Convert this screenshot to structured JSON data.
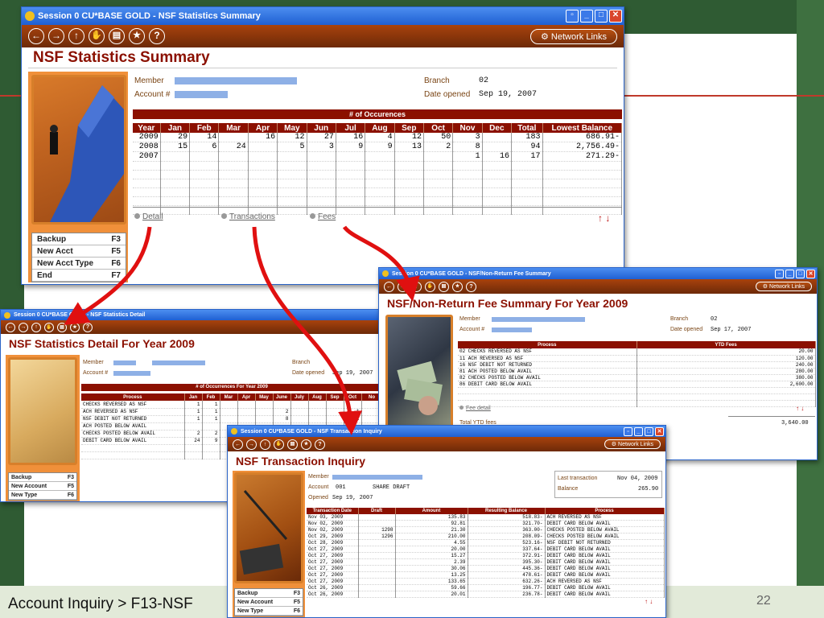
{
  "slide": {
    "caption": "Account Inquiry > F13-NSF",
    "page_number": "22"
  },
  "summary": {
    "window_title": "Session 0 CU*BASE GOLD - NSF Statistics Summary",
    "page_title": "NSF Statistics Summary",
    "network_links": "Network Links",
    "member_label": "Member",
    "account_label": "Account #",
    "branch_label": "Branch",
    "branch_value": "02",
    "date_opened_label": "Date opened",
    "date_opened_value": "Sep 19, 2007",
    "occurrences_header": "# of Occurences",
    "columns": [
      "Year",
      "Jan",
      "Feb",
      "Mar",
      "Apr",
      "May",
      "Jun",
      "Jul",
      "Aug",
      "Sep",
      "Oct",
      "Nov",
      "Dec",
      "Total",
      "Lowest Balance"
    ],
    "rows": [
      [
        "2009",
        "29",
        "14",
        "",
        "16",
        "12",
        "27",
        "16",
        "4",
        "12",
        "50",
        "3",
        "",
        "183",
        "686.91-"
      ],
      [
        "2008",
        "15",
        "6",
        "24",
        "",
        "5",
        "3",
        "9",
        "9",
        "13",
        "2",
        "8",
        "",
        "94",
        "2,756.49-"
      ],
      [
        "2007",
        "",
        "",
        "",
        "",
        "",
        "",
        "",
        "",
        "",
        "",
        "1",
        "16",
        "17",
        "271.29-"
      ]
    ],
    "links": [
      "Detail",
      "Transactions",
      "Fees"
    ],
    "fkeys": [
      [
        "Backup",
        "F3"
      ],
      [
        "New Acct",
        "F5"
      ],
      [
        "New Acct Type",
        "F6"
      ],
      [
        "End",
        "F7"
      ]
    ]
  },
  "detail": {
    "window_title": "Session 0 CU*BASE GOLD - NSF Statistics Detail",
    "page_title": "NSF Statistics Detail For Year 2009",
    "member_label": "Member",
    "account_label": "Account #",
    "branch_label": "Branch",
    "date_opened_label": "Date opened",
    "date_opened_value": "Sep 19, 2007",
    "grid_header": "# of Occurrences For Year 2009",
    "columns": [
      "Process",
      "Jan",
      "Feb",
      "Mar",
      "Apr",
      "May",
      "June",
      "July",
      "Aug",
      "Sep",
      "Oct",
      "No"
    ],
    "rows": [
      [
        "CHECKS REVERSED AS NSF",
        "1",
        "1",
        "",
        "",
        "",
        "",
        "",
        "",
        "",
        "",
        ""
      ],
      [
        "ACH REVERSED AS NSF",
        "1",
        "1",
        "",
        "",
        "",
        "2",
        "",
        "",
        "",
        "1",
        ""
      ],
      [
        "NSF DEBIT NOT RETURNED",
        "1",
        "1",
        "",
        "",
        "",
        "8",
        "",
        "",
        "",
        "2",
        ""
      ],
      [
        "ACH POSTED BELOW AVAIL",
        "",
        "",
        "",
        "",
        "",
        "",
        "",
        "",
        "",
        "",
        ""
      ],
      [
        "CHECKS POSTED BELOW AVAIL",
        "2",
        "2",
        "",
        "",
        "",
        "",
        "",
        "",
        "",
        "",
        ""
      ],
      [
        "DEBIT CARD BELOW AVAIL",
        "24",
        "9",
        "",
        "",
        "",
        "",
        "",
        "",
        "",
        "",
        ""
      ]
    ],
    "fkeys": [
      [
        "Backup",
        "F3"
      ],
      [
        "New Account",
        "F5"
      ],
      [
        "New Type",
        "F6"
      ]
    ]
  },
  "fees": {
    "window_title": "Session 0 CU*BASE GOLD - NSF/Non-Return Fee Summary",
    "page_title": "NSF/Non-Return Fee Summary For Year 2009",
    "network_links": "Network Links",
    "member_label": "Member",
    "account_label": "Account #",
    "branch_label": "Branch",
    "branch_value": "02",
    "date_opened_label": "Date opened",
    "date_opened_value": "Sep 17, 2007",
    "columns": [
      "Process",
      "YTD Fees"
    ],
    "rows": [
      [
        "02 CHECKS REVERSED AS NSF",
        "20.00"
      ],
      [
        "11 ACH REVERSED AS NSF",
        "120.00"
      ],
      [
        "16 NSF DEBIT NOT RETURNED",
        "240.00"
      ],
      [
        "81 ACH POSTED BELOW AVAIL",
        "280.00"
      ],
      [
        "82 CHECKS POSTED BELOW AVAIL",
        "380.00"
      ],
      [
        "86 DEBIT CARD BELOW AVAIL",
        "2,600.00"
      ]
    ],
    "fee_detail_link": "Fee detail",
    "total_label": "Total YTD fees",
    "total_value": "3,640.00"
  },
  "transactions": {
    "window_title": "Session 0 CU*BASE GOLD - NSF Transaction Inquiry",
    "page_title": "NSF Transaction Inquiry",
    "network_links": "Network Links",
    "member_label": "Member",
    "account_label": "Account",
    "account_value": "001",
    "account_type": "SHARE DRAFT",
    "opened_label": "Opened",
    "opened_value": "Sep 19, 2007",
    "last_tx_label": "Last transaction",
    "last_tx_value": "Nov 04, 2009",
    "balance_label": "Balance",
    "balance_value": "265.90",
    "columns": [
      "Transaction Date",
      "Draft",
      "Amount",
      "Resulting Balance",
      "Process"
    ],
    "rows": [
      [
        "Nov 03, 2009",
        "",
        "135.83",
        "518.83-",
        "ACH REVERSED AS NSF"
      ],
      [
        "Nov 02, 2009",
        "",
        "92.81",
        "321.70-",
        "DEBIT CARD BELOW AVAIL"
      ],
      [
        "Nov 02, 2009",
        "1298",
        "21.30",
        "363.00-",
        "CHECKS POSTED BELOW AVAIL"
      ],
      [
        "Oct 29, 2009",
        "1296",
        "210.00",
        "208.09-",
        "CHECKS POSTED BELOW AVAIL"
      ],
      [
        "Oct 28, 2009",
        "",
        "4.55",
        "523.16-",
        "NSF DEBIT NOT RETURNED"
      ],
      [
        "Oct 27, 2009",
        "",
        "20.00",
        "337.64-",
        "DEBIT CARD BELOW AVAIL"
      ],
      [
        "Oct 27, 2009",
        "",
        "15.27",
        "372.91-",
        "DEBIT CARD BELOW AVAIL"
      ],
      [
        "Oct 27, 2009",
        "",
        "2.39",
        "395.30-",
        "DEBIT CARD BELOW AVAIL"
      ],
      [
        "Oct 27, 2009",
        "",
        "30.06",
        "445.36-",
        "DEBIT CARD BELOW AVAIL"
      ],
      [
        "Oct 27, 2009",
        "",
        "13.25",
        "478.61-",
        "DEBIT CARD BELOW AVAIL"
      ],
      [
        "Oct 27, 2009",
        "",
        "133.65",
        "632.26-",
        "ACH REVERSED AS NSF"
      ],
      [
        "Oct 26, 2009",
        "",
        "59.66",
        "196.77-",
        "DEBIT CARD BELOW AVAIL"
      ],
      [
        "Oct 26, 2009",
        "",
        "20.01",
        "236.78-",
        "DEBIT CARD BELOW AVAIL"
      ]
    ],
    "fkeys": [
      [
        "Backup",
        "F3"
      ],
      [
        "New Account",
        "F5"
      ],
      [
        "New Type",
        "F6"
      ]
    ]
  },
  "colors": {
    "accent": "#8b1000",
    "toolbar": "#8a3510",
    "arrow": "#e01010",
    "mask": "#8eb0e6"
  }
}
